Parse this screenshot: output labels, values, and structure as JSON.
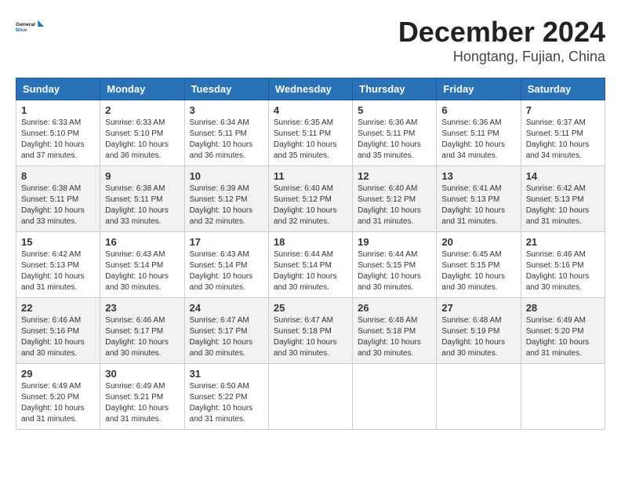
{
  "logo": {
    "line1": "General",
    "line2": "Blue"
  },
  "title": "December 2024",
  "subtitle": "Hongtang, Fujian, China",
  "headers": [
    "Sunday",
    "Monday",
    "Tuesday",
    "Wednesday",
    "Thursday",
    "Friday",
    "Saturday"
  ],
  "weeks": [
    [
      {
        "day": "1",
        "sunrise": "Sunrise: 6:33 AM",
        "sunset": "Sunset: 5:10 PM",
        "daylight": "Daylight: 10 hours and 37 minutes."
      },
      {
        "day": "2",
        "sunrise": "Sunrise: 6:33 AM",
        "sunset": "Sunset: 5:10 PM",
        "daylight": "Daylight: 10 hours and 36 minutes."
      },
      {
        "day": "3",
        "sunrise": "Sunrise: 6:34 AM",
        "sunset": "Sunset: 5:11 PM",
        "daylight": "Daylight: 10 hours and 36 minutes."
      },
      {
        "day": "4",
        "sunrise": "Sunrise: 6:35 AM",
        "sunset": "Sunset: 5:11 PM",
        "daylight": "Daylight: 10 hours and 35 minutes."
      },
      {
        "day": "5",
        "sunrise": "Sunrise: 6:36 AM",
        "sunset": "Sunset: 5:11 PM",
        "daylight": "Daylight: 10 hours and 35 minutes."
      },
      {
        "day": "6",
        "sunrise": "Sunrise: 6:36 AM",
        "sunset": "Sunset: 5:11 PM",
        "daylight": "Daylight: 10 hours and 34 minutes."
      },
      {
        "day": "7",
        "sunrise": "Sunrise: 6:37 AM",
        "sunset": "Sunset: 5:11 PM",
        "daylight": "Daylight: 10 hours and 34 minutes."
      }
    ],
    [
      {
        "day": "8",
        "sunrise": "Sunrise: 6:38 AM",
        "sunset": "Sunset: 5:11 PM",
        "daylight": "Daylight: 10 hours and 33 minutes."
      },
      {
        "day": "9",
        "sunrise": "Sunrise: 6:38 AM",
        "sunset": "Sunset: 5:11 PM",
        "daylight": "Daylight: 10 hours and 33 minutes."
      },
      {
        "day": "10",
        "sunrise": "Sunrise: 6:39 AM",
        "sunset": "Sunset: 5:12 PM",
        "daylight": "Daylight: 10 hours and 32 minutes."
      },
      {
        "day": "11",
        "sunrise": "Sunrise: 6:40 AM",
        "sunset": "Sunset: 5:12 PM",
        "daylight": "Daylight: 10 hours and 32 minutes."
      },
      {
        "day": "12",
        "sunrise": "Sunrise: 6:40 AM",
        "sunset": "Sunset: 5:12 PM",
        "daylight": "Daylight: 10 hours and 31 minutes."
      },
      {
        "day": "13",
        "sunrise": "Sunrise: 6:41 AM",
        "sunset": "Sunset: 5:13 PM",
        "daylight": "Daylight: 10 hours and 31 minutes."
      },
      {
        "day": "14",
        "sunrise": "Sunrise: 6:42 AM",
        "sunset": "Sunset: 5:13 PM",
        "daylight": "Daylight: 10 hours and 31 minutes."
      }
    ],
    [
      {
        "day": "15",
        "sunrise": "Sunrise: 6:42 AM",
        "sunset": "Sunset: 5:13 PM",
        "daylight": "Daylight: 10 hours and 31 minutes."
      },
      {
        "day": "16",
        "sunrise": "Sunrise: 6:43 AM",
        "sunset": "Sunset: 5:14 PM",
        "daylight": "Daylight: 10 hours and 30 minutes."
      },
      {
        "day": "17",
        "sunrise": "Sunrise: 6:43 AM",
        "sunset": "Sunset: 5:14 PM",
        "daylight": "Daylight: 10 hours and 30 minutes."
      },
      {
        "day": "18",
        "sunrise": "Sunrise: 6:44 AM",
        "sunset": "Sunset: 5:14 PM",
        "daylight": "Daylight: 10 hours and 30 minutes."
      },
      {
        "day": "19",
        "sunrise": "Sunrise: 6:44 AM",
        "sunset": "Sunset: 5:15 PM",
        "daylight": "Daylight: 10 hours and 30 minutes."
      },
      {
        "day": "20",
        "sunrise": "Sunrise: 6:45 AM",
        "sunset": "Sunset: 5:15 PM",
        "daylight": "Daylight: 10 hours and 30 minutes."
      },
      {
        "day": "21",
        "sunrise": "Sunrise: 6:46 AM",
        "sunset": "Sunset: 5:16 PM",
        "daylight": "Daylight: 10 hours and 30 minutes."
      }
    ],
    [
      {
        "day": "22",
        "sunrise": "Sunrise: 6:46 AM",
        "sunset": "Sunset: 5:16 PM",
        "daylight": "Daylight: 10 hours and 30 minutes."
      },
      {
        "day": "23",
        "sunrise": "Sunrise: 6:46 AM",
        "sunset": "Sunset: 5:17 PM",
        "daylight": "Daylight: 10 hours and 30 minutes."
      },
      {
        "day": "24",
        "sunrise": "Sunrise: 6:47 AM",
        "sunset": "Sunset: 5:17 PM",
        "daylight": "Daylight: 10 hours and 30 minutes."
      },
      {
        "day": "25",
        "sunrise": "Sunrise: 6:47 AM",
        "sunset": "Sunset: 5:18 PM",
        "daylight": "Daylight: 10 hours and 30 minutes."
      },
      {
        "day": "26",
        "sunrise": "Sunrise: 6:48 AM",
        "sunset": "Sunset: 5:18 PM",
        "daylight": "Daylight: 10 hours and 30 minutes."
      },
      {
        "day": "27",
        "sunrise": "Sunrise: 6:48 AM",
        "sunset": "Sunset: 5:19 PM",
        "daylight": "Daylight: 10 hours and 30 minutes."
      },
      {
        "day": "28",
        "sunrise": "Sunrise: 6:49 AM",
        "sunset": "Sunset: 5:20 PM",
        "daylight": "Daylight: 10 hours and 31 minutes."
      }
    ],
    [
      {
        "day": "29",
        "sunrise": "Sunrise: 6:49 AM",
        "sunset": "Sunset: 5:20 PM",
        "daylight": "Daylight: 10 hours and 31 minutes."
      },
      {
        "day": "30",
        "sunrise": "Sunrise: 6:49 AM",
        "sunset": "Sunset: 5:21 PM",
        "daylight": "Daylight: 10 hours and 31 minutes."
      },
      {
        "day": "31",
        "sunrise": "Sunrise: 6:50 AM",
        "sunset": "Sunset: 5:22 PM",
        "daylight": "Daylight: 10 hours and 31 minutes."
      },
      null,
      null,
      null,
      null
    ]
  ]
}
